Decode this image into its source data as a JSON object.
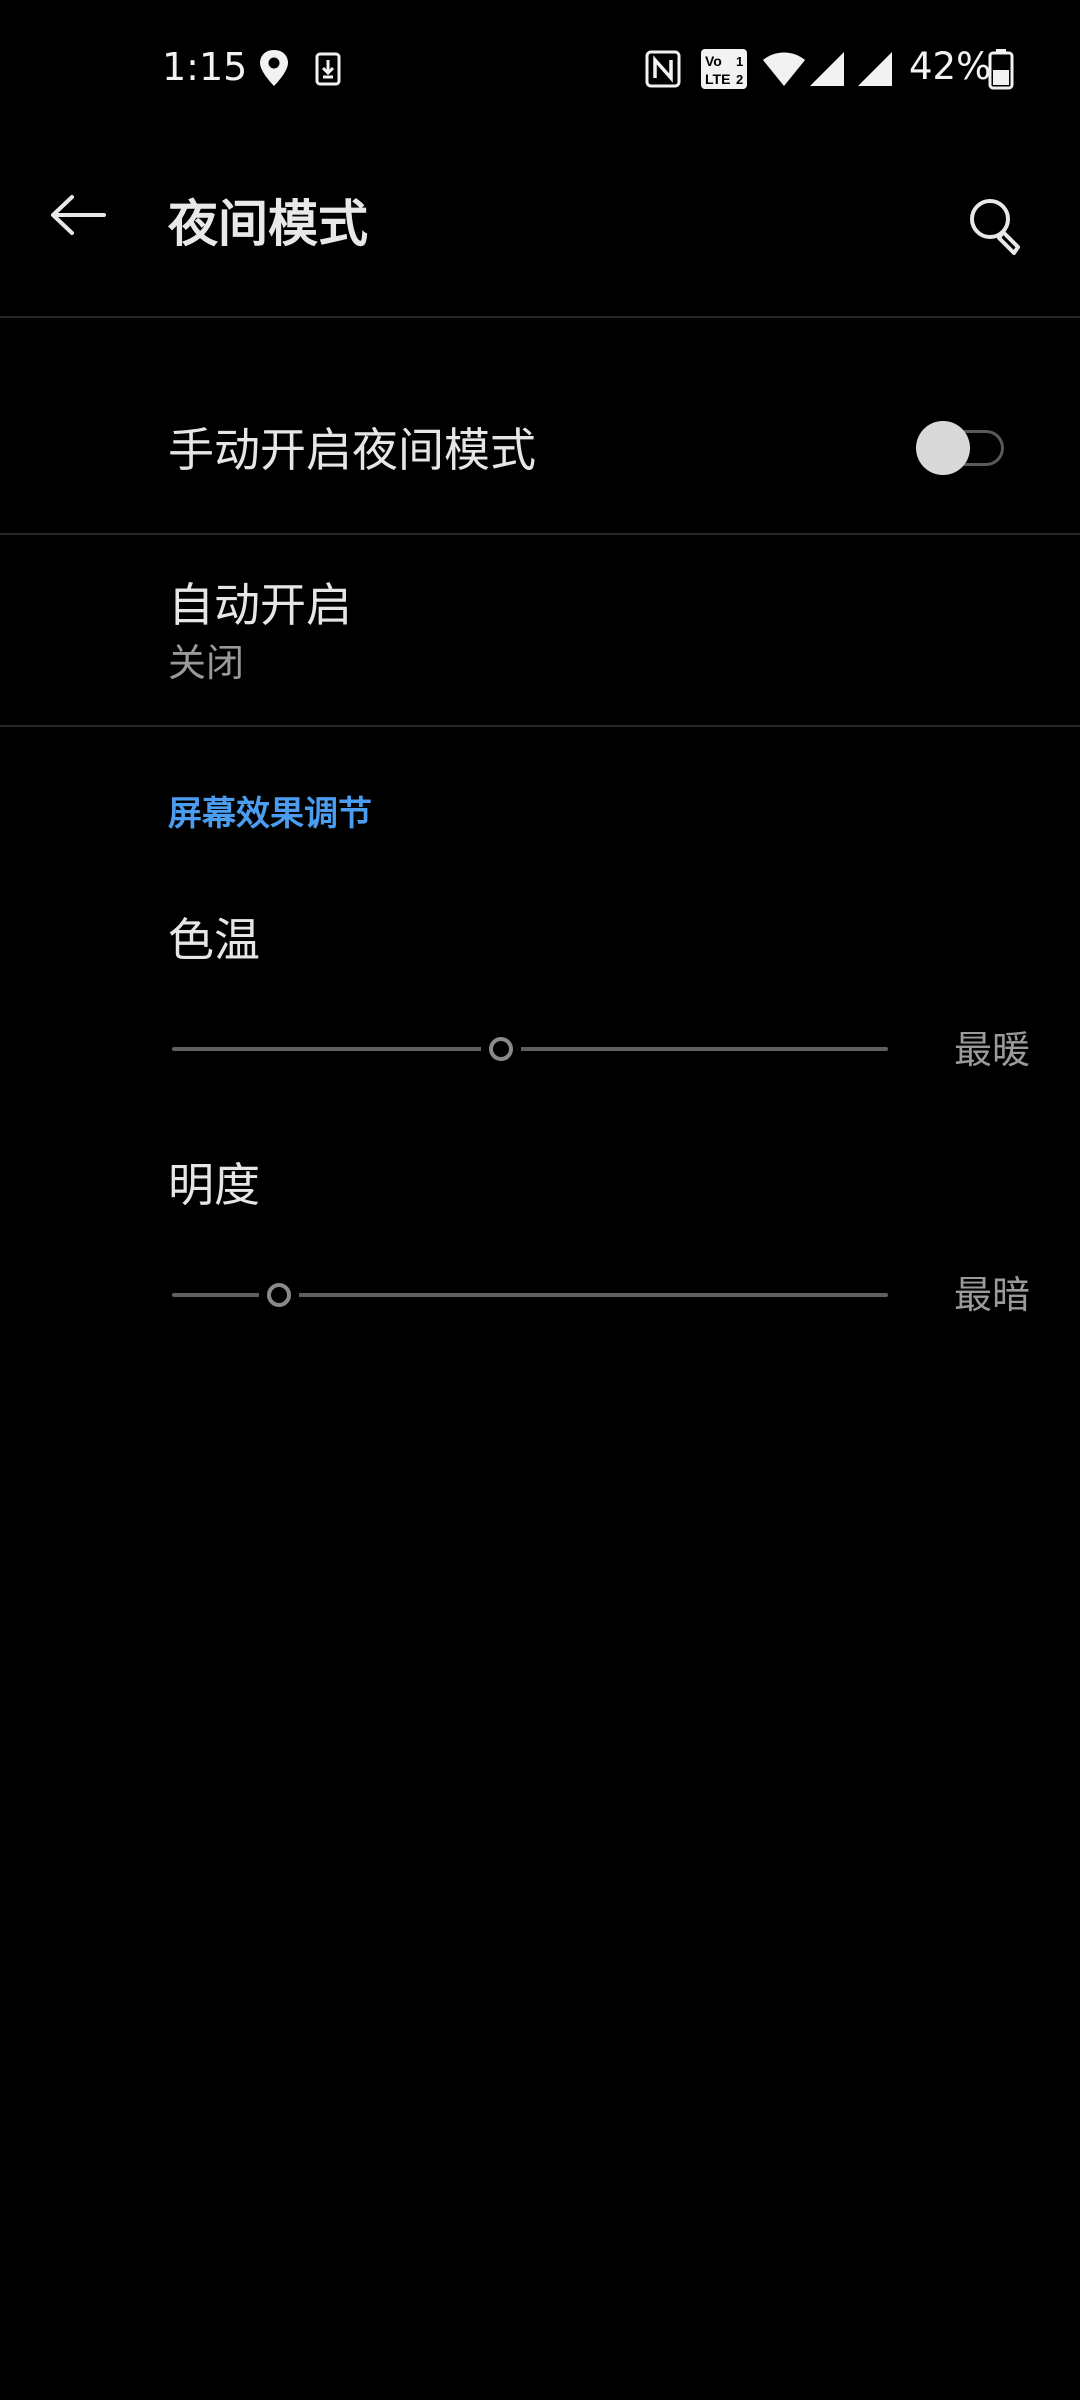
{
  "status_bar": {
    "time": "1:15",
    "battery_percent": "42%",
    "battery_level": 0.42,
    "icons": [
      "location-icon",
      "download-icon",
      "nfc-icon",
      "volte-icon",
      "wifi-icon",
      "signal-icon",
      "signal-icon",
      "battery-icon"
    ]
  },
  "header": {
    "title": "夜间模式",
    "back_icon": "arrow-left-icon",
    "search_icon": "search-icon"
  },
  "settings": {
    "manual_on": {
      "label": "手动开启夜间模式",
      "enabled": false
    },
    "auto_on": {
      "label": "自动开启",
      "value": "关闭"
    }
  },
  "screen_effects": {
    "header": "屏幕效果调节",
    "color_temp": {
      "label": "色温",
      "end_label": "最暖",
      "value": 0.46
    },
    "brightness": {
      "label": "明度",
      "end_label": "最暗",
      "value": 0.15
    }
  },
  "colors": {
    "background": "#000000",
    "accent": "#4a9df0",
    "text_primary": "#e6e6e6",
    "text_secondary": "#9a9a9a"
  }
}
